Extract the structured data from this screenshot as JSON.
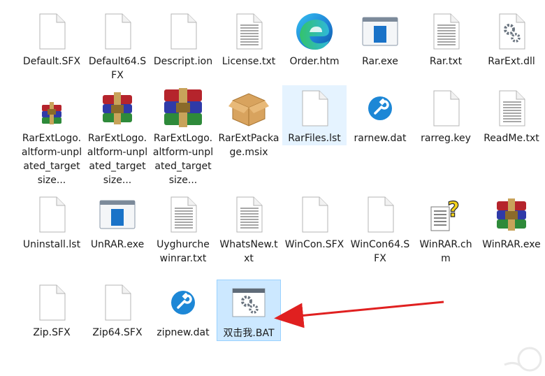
{
  "files": [
    {
      "name": "Default.SFX",
      "icon": "blank-file-icon"
    },
    {
      "name": "Default64.SFX",
      "icon": "blank-file-icon"
    },
    {
      "name": "Descript.ion",
      "icon": "blank-file-icon"
    },
    {
      "name": "License.txt",
      "icon": "text-file-icon"
    },
    {
      "name": "Order.htm",
      "icon": "edge-browser-icon"
    },
    {
      "name": "Rar.exe",
      "icon": "console-app-icon"
    },
    {
      "name": "Rar.txt",
      "icon": "text-file-icon"
    },
    {
      "name": "RarExt.dll",
      "icon": "gear-file-icon"
    },
    {
      "name": "RarExtLogo.altform-unplated_targetsize...",
      "icon": "winrar-small-icon"
    },
    {
      "name": "RarExtLogo.altform-unplated_targetsize...",
      "icon": "winrar-books-icon"
    },
    {
      "name": "RarExtLogo.altform-unplated_targetsize...",
      "icon": "winrar-books-large-icon"
    },
    {
      "name": "RarExtPackage.msix",
      "icon": "package-box-icon"
    },
    {
      "name": "RarFiles.lst",
      "icon": "blank-file-icon",
      "state": "hover"
    },
    {
      "name": "rarnew.dat",
      "icon": "wrench-circle-icon"
    },
    {
      "name": "rarreg.key",
      "icon": "blank-file-icon"
    },
    {
      "name": "ReadMe.txt",
      "icon": "text-file-icon"
    },
    {
      "name": "Uninstall.lst",
      "icon": "blank-file-icon"
    },
    {
      "name": "UnRAR.exe",
      "icon": "console-app-icon"
    },
    {
      "name": "Uyghurche winrar.txt",
      "icon": "text-file-icon"
    },
    {
      "name": "WhatsNew.txt",
      "icon": "text-file-icon"
    },
    {
      "name": "WinCon.SFX",
      "icon": "blank-file-icon"
    },
    {
      "name": "WinCon64.SFX",
      "icon": "blank-file-icon"
    },
    {
      "name": "WinRAR.chm",
      "icon": "help-file-icon"
    },
    {
      "name": "WinRAR.exe",
      "icon": "winrar-books-icon"
    },
    {
      "name": "Zip.SFX",
      "icon": "blank-file-icon"
    },
    {
      "name": "Zip64.SFX",
      "icon": "blank-file-icon"
    },
    {
      "name": "zipnew.dat",
      "icon": "wrench-circle-icon"
    },
    {
      "name": "双击我.BAT",
      "icon": "batch-gear-icon",
      "state": "selected"
    }
  ],
  "annotation": {
    "type": "red-arrow",
    "color": "#e02020",
    "points_to": "双击我.BAT"
  },
  "colors": {
    "selection": "#cce8ff",
    "selection_border": "#99d1ff",
    "hover": "#e5f3ff"
  }
}
